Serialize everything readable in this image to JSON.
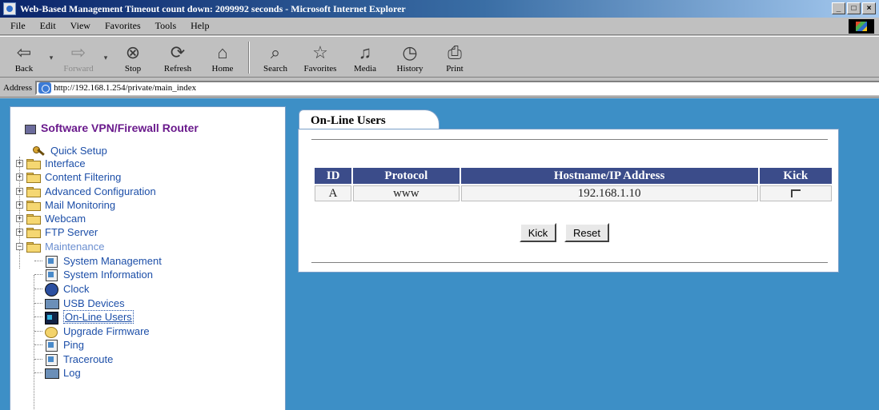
{
  "window": {
    "title": "Web-Based Management Timeout count down: 2099992 seconds - Microsoft Internet Explorer",
    "min": "_",
    "max": "□",
    "close": "×"
  },
  "menubar": {
    "items": [
      "File",
      "Edit",
      "View",
      "Favorites",
      "Tools",
      "Help"
    ]
  },
  "toolbar": {
    "back": "Back",
    "forward": "Forward",
    "stop": "Stop",
    "refresh": "Refresh",
    "home": "Home",
    "search": "Search",
    "favorites": "Favorites",
    "media": "Media",
    "history": "History",
    "print": "Print"
  },
  "address": {
    "label": "Address",
    "url": "http://192.168.1.254/private/main_index"
  },
  "sidebar": {
    "title": "Software VPN/Firewall Router",
    "items": [
      {
        "label": "Quick Setup"
      },
      {
        "label": "Interface"
      },
      {
        "label": "Content Filtering"
      },
      {
        "label": "Advanced Configuration"
      },
      {
        "label": "Mail Monitoring"
      },
      {
        "label": "Webcam"
      },
      {
        "label": "FTP Server"
      },
      {
        "label": "Maintenance"
      },
      {
        "label": "System Management"
      },
      {
        "label": "System Information"
      },
      {
        "label": "Clock"
      },
      {
        "label": "USB Devices"
      },
      {
        "label": "On-Line Users"
      },
      {
        "label": "Upgrade Firmware"
      },
      {
        "label": "Ping"
      },
      {
        "label": "Traceroute"
      },
      {
        "label": "Log"
      }
    ]
  },
  "main": {
    "tab": "On-Line Users",
    "table": {
      "headers": [
        "ID",
        "Protocol",
        "Hostname/IP Address",
        "Kick"
      ],
      "rows": [
        {
          "id": "A",
          "protocol": "www",
          "host": "192.168.1.10",
          "kick_checked": false
        }
      ]
    },
    "kick_button": "Kick",
    "reset_button": "Reset"
  },
  "colors": {
    "content_bg": "#3d8fc6",
    "table_header": "#3b4c8a",
    "sidebar_title": "#6a1a8c",
    "tree_text": "#1d4fa8"
  }
}
